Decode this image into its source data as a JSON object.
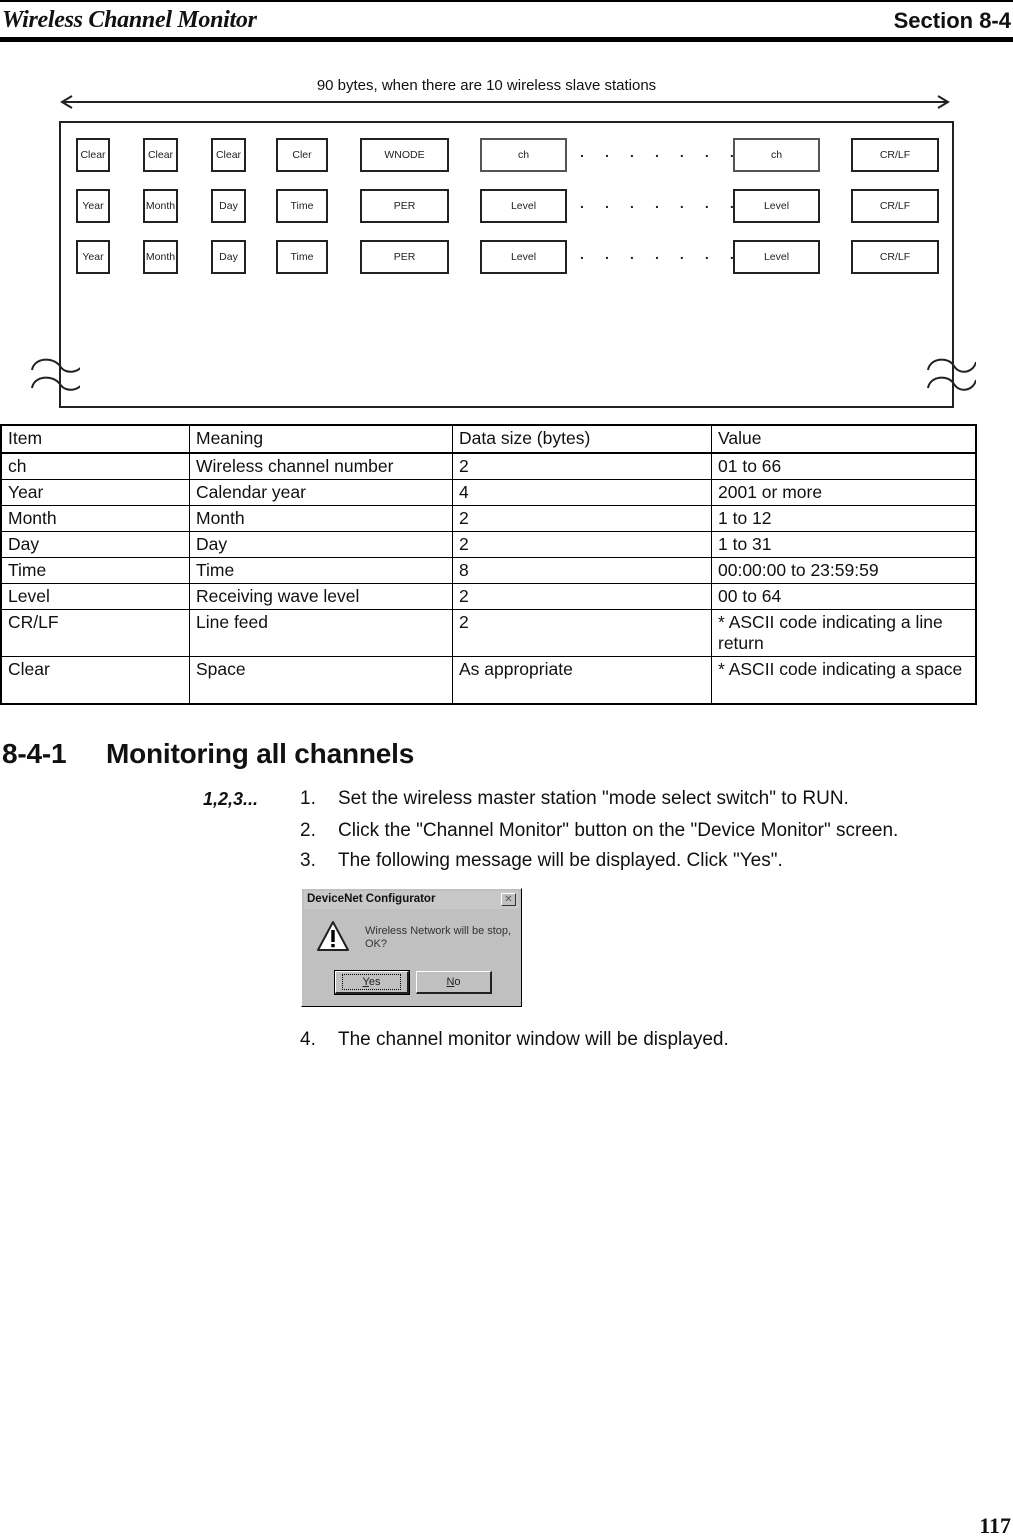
{
  "header": {
    "chapter_title": "Wireless Channel Monitor",
    "section_label": "Section 8-4"
  },
  "diagram": {
    "span_label": "90 bytes, when there are 10 wireless slave stations",
    "rows": [
      {
        "cells": [
          "Clear",
          "Clear",
          "Clear",
          "Cler",
          "WNODE",
          "ch"
        ],
        "ellipsis": ". . . . . . . . .",
        "last_cell": "ch",
        "terminator": "CR/LF"
      },
      {
        "cells": [
          "Year",
          "Month",
          "Day",
          "Time",
          "PER",
          "Level"
        ],
        "ellipsis": ". . . . . . . . .",
        "last_cell": "Level",
        "terminator": "CR/LF"
      },
      {
        "cells": [
          "Year",
          "Month",
          "Day",
          "Time",
          "PER",
          "Level"
        ],
        "ellipsis": ". . . . . . . . .",
        "last_cell": "Level",
        "terminator": "CR/LF"
      }
    ]
  },
  "table": {
    "headers": [
      "Item",
      "Meaning",
      "Data size (bytes)",
      "Value"
    ],
    "rows": [
      [
        "ch",
        "Wireless channel number",
        "2",
        "01 to 66"
      ],
      [
        "Year",
        "Calendar year",
        "4",
        "2001 or more"
      ],
      [
        "Month",
        "Month",
        "2",
        "1 to 12"
      ],
      [
        "Day",
        "Day",
        "2",
        "1 to 31"
      ],
      [
        "Time",
        "Time",
        "8",
        "00:00:00 to 23:59:59"
      ],
      [
        "Level",
        "Receiving wave level",
        "2",
        "00 to 64"
      ],
      [
        "CR/LF",
        "Line feed",
        "2",
        "* ASCII code indicating a line return"
      ],
      [
        "Clear",
        "Space",
        "As appropriate",
        "* ASCII code indicating a space"
      ]
    ]
  },
  "section": {
    "number": "8-4-1",
    "title": "Monitoring all channels",
    "steps_label": "1,2,3...",
    "steps": [
      {
        "n": "1.",
        "text": "Set the wireless master station \"mode select switch\" to RUN."
      },
      {
        "n": "2.",
        "text": "Click the \"Channel Monitor\" button on the \"Device Monitor\" screen."
      },
      {
        "n": "3.",
        "text": "The following message will be displayed. Click \"Yes\"."
      },
      {
        "n": "4.",
        "text": "The channel monitor window will be displayed."
      }
    ]
  },
  "dialog": {
    "title": "DeviceNet Configurator",
    "close_glyph": "✕",
    "message_line1": "Wireless Network will be stop,",
    "message_line2": "OK?",
    "yes_mnemonic": "Y",
    "yes_rest": "es",
    "no_mnemonic": "N",
    "no_rest": "o"
  },
  "footer": {
    "page_number": "117"
  }
}
